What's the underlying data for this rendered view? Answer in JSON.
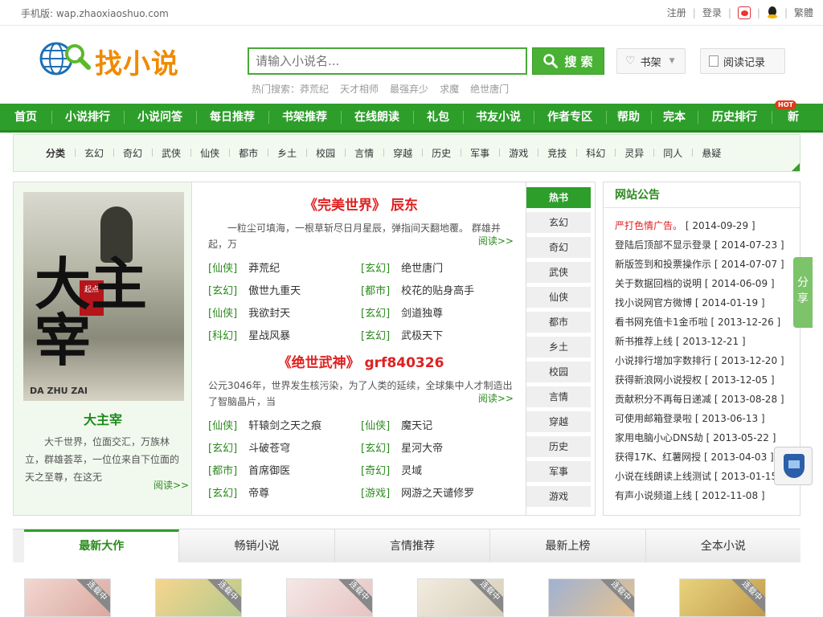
{
  "topbar": {
    "mobile_label": "手机版: wap.zhaoxiaoshuo.com",
    "register": "注册",
    "login": "登录",
    "traditional": "繁體"
  },
  "logo": {
    "text": "找小说"
  },
  "search": {
    "placeholder": "请输入小说名...",
    "button_label": "搜 索"
  },
  "hot_search": {
    "label": "热门搜索：",
    "terms": [
      "莽荒纪",
      "天才相师",
      "最强弃少",
      "求魔",
      "绝世唐门"
    ]
  },
  "header_buttons": {
    "bookshelf": "书架",
    "history": "阅读记录"
  },
  "nav": {
    "items": [
      "首页",
      "小说排行",
      "小说问答",
      "每日推荐",
      "书架推荐",
      "在线朗读",
      "礼包",
      "书友小说",
      "作者专区",
      "帮助",
      "完本",
      "历史排行",
      "新"
    ],
    "hot_badge": "HOT"
  },
  "categories": [
    "分类",
    "玄幻",
    "奇幻",
    "武侠",
    "仙侠",
    "都市",
    "乡土",
    "校园",
    "言情",
    "穿越",
    "历史",
    "军事",
    "游戏",
    "竞技",
    "科幻",
    "灵异",
    "同人",
    "悬疑"
  ],
  "featured": {
    "cover_title": "大主宰",
    "cover_en": "DA ZHU ZAI",
    "title": "大主宰",
    "desc": "大千世界，位面交汇，万族林立，群雄荟萃，一位位来自下位面的天之至尊，在这无",
    "readmore": "阅读>>"
  },
  "sections": [
    {
      "title": "《完美世界》 辰东",
      "desc": "一粒尘可填海，一根草斩尽日月星辰，弹指间天翻地覆。 群雄并起，万",
      "readmore": "阅读>>",
      "books": [
        {
          "tag": "[仙侠]",
          "name": "莽荒纪"
        },
        {
          "tag": "[玄幻]",
          "name": "绝世唐门"
        },
        {
          "tag": "[玄幻]",
          "name": "傲世九重天"
        },
        {
          "tag": "[都市]",
          "name": "校花的贴身高手"
        },
        {
          "tag": "[仙侠]",
          "name": "我欲封天"
        },
        {
          "tag": "[玄幻]",
          "name": "剑道独尊"
        },
        {
          "tag": "[科幻]",
          "name": "星战风暴"
        },
        {
          "tag": "[玄幻]",
          "name": "武极天下"
        }
      ]
    },
    {
      "title": "《绝世武神》 grf840326",
      "desc": "公元3046年，世界发生核污染，为了人类的延续，全球集中人才制造出了智脑晶片，当",
      "readmore": "阅读>>",
      "books": [
        {
          "tag": "[仙侠]",
          "name": "轩辕剑之天之痕"
        },
        {
          "tag": "[仙侠]",
          "name": "魔天记"
        },
        {
          "tag": "[玄幻]",
          "name": "斗破苍穹"
        },
        {
          "tag": "[玄幻]",
          "name": "星河大帝"
        },
        {
          "tag": "[都市]",
          "name": "首席御医"
        },
        {
          "tag": "[奇幻]",
          "name": "灵域"
        },
        {
          "tag": "[玄幻]",
          "name": "帝尊"
        },
        {
          "tag": "[游戏]",
          "name": "网游之天谴修罗"
        }
      ]
    }
  ],
  "side_tabs": [
    "热书",
    "玄幻",
    "奇幻",
    "武侠",
    "仙侠",
    "都市",
    "乡土",
    "校园",
    "言情",
    "穿越",
    "历史",
    "军事",
    "游戏"
  ],
  "notice": {
    "title": "网站公告",
    "items": [
      {
        "text": "严打色情广告。",
        "date": "[ 2014-09-29 ]",
        "highlight": true
      },
      {
        "text": "登陆后顶部不显示登录",
        "date": "[ 2014-07-23 ]"
      },
      {
        "text": "新版签到和投票操作示",
        "date": "[ 2014-07-07 ]"
      },
      {
        "text": "关于数据回档的说明",
        "date": "[ 2014-06-09 ]"
      },
      {
        "text": "找小说网官方微博",
        "date": "[ 2014-01-19 ]"
      },
      {
        "text": "看书网充值卡1金币啦",
        "date": "[ 2013-12-26 ]"
      },
      {
        "text": "新书推荐上线",
        "date": "[ 2013-12-21 ]"
      },
      {
        "text": "小说排行增加字数排行",
        "date": "[ 2013-12-20 ]"
      },
      {
        "text": "获得新浪网小说授权",
        "date": "[ 2013-12-05 ]"
      },
      {
        "text": "贡献积分不再每日递减",
        "date": "[ 2013-08-28 ]"
      },
      {
        "text": "可使用邮箱登录啦",
        "date": "[ 2013-06-13 ]"
      },
      {
        "text": "家用电脑小心DNS劫",
        "date": "[ 2013-05-22 ]"
      },
      {
        "text": "获得17K、红薯网授",
        "date": "[ 2013-04-03 ]"
      },
      {
        "text": "小说在线朗读上线测试",
        "date": "[ 2013-01-15 ]"
      },
      {
        "text": "有声小说频道上线",
        "date": "[ 2012-11-08 ]"
      }
    ]
  },
  "share": {
    "label": "分享"
  },
  "bottom_tabs": [
    "最新大作",
    "畅销小说",
    "言情推荐",
    "最新上榜",
    "全本小说"
  ],
  "thumb_ribbon": "连载中",
  "colors": {
    "brand_green": "#2d9e2a",
    "accent_red": "#e02020",
    "link_green": "#2c8a1e"
  }
}
